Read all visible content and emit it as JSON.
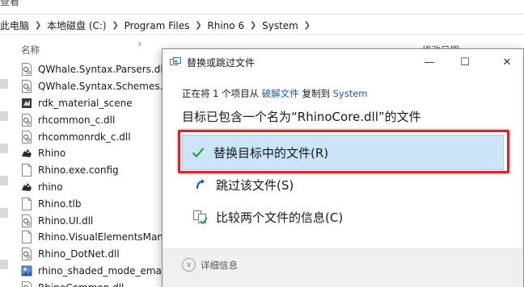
{
  "explorer": {
    "ribbon_label": "查看",
    "breadcrumbs": [
      "此电脑",
      "本地磁盘 (C:)",
      "Program Files",
      "Rhino 6",
      "System"
    ],
    "columns": {
      "name": "名称",
      "date": "修改日期"
    },
    "files": [
      {
        "name": "QWhale.Syntax.Parsers.dll",
        "icon": "dll-file-icon"
      },
      {
        "name": "QWhale.Syntax.Schemes.dll",
        "icon": "dll-file-icon"
      },
      {
        "name": "rdk_material_scene",
        "icon": "rhino-file-icon"
      },
      {
        "name": "rhcommon_c.dll",
        "icon": "dll-file-icon"
      },
      {
        "name": "rhcommonrdk_c.dll",
        "icon": "dll-file-icon"
      },
      {
        "name": "Rhino",
        "icon": "rhino-app-icon"
      },
      {
        "name": "Rhino.exe.config",
        "icon": "blank-file-icon"
      },
      {
        "name": "rhino",
        "icon": "rhino-app-icon"
      },
      {
        "name": "Rhino.tlb",
        "icon": "blank-file-icon"
      },
      {
        "name": "Rhino.UI.dll",
        "icon": "dll-file-icon"
      },
      {
        "name": "Rhino.VisualElementsMani",
        "icon": "blank-file-icon"
      },
      {
        "name": "Rhino_DotNet.dll",
        "icon": "dll-file-icon"
      },
      {
        "name": "rhino_shaded_mode_emap",
        "icon": "image-file-icon"
      },
      {
        "name": "RhinoCommon.dll",
        "icon": "dll-file-icon"
      }
    ]
  },
  "dialog": {
    "title": "替换或跳过文件",
    "info": {
      "prefix": "正在将 1 个项目从",
      "source": "破解文件",
      "middle": "复制到",
      "destination": "System"
    },
    "heading": "目标已包含一个名为“RhinoCore.dll”的文件",
    "options": {
      "replace": "替换目标中的文件(R)",
      "skip": "跳过该文件(S)",
      "compare": "比较两个文件的信息(C)"
    },
    "details_label": "详细信息",
    "window_buttons": {
      "minimize": "—",
      "maximize": "☐",
      "close": "✕"
    }
  },
  "colors": {
    "link": "#1e5aa8",
    "selected_option": "#cce4f7",
    "highlight_frame": "#d6252b",
    "check_green": "#2a9d3b"
  }
}
